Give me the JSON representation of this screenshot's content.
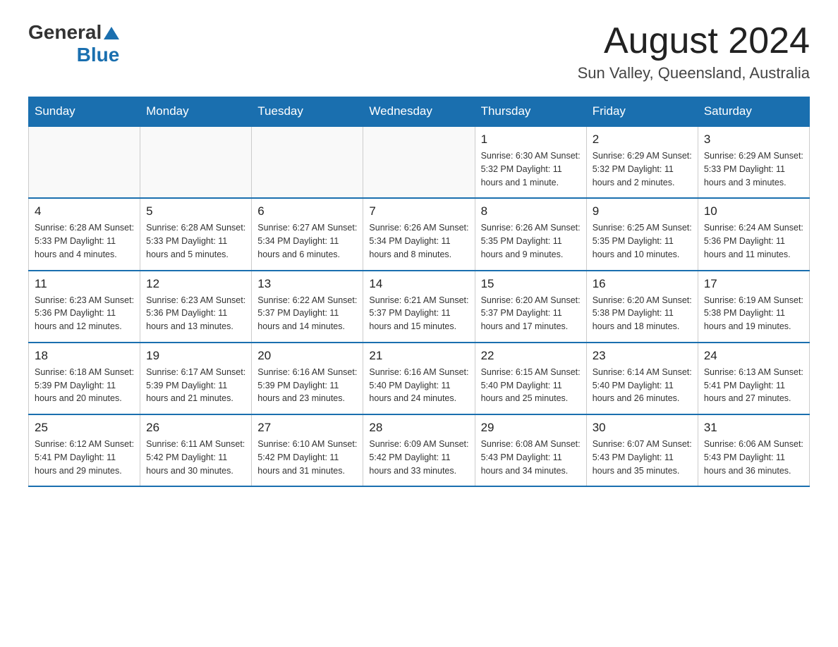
{
  "header": {
    "logo_general": "General",
    "logo_blue": "Blue",
    "month_title": "August 2024",
    "location": "Sun Valley, Queensland, Australia"
  },
  "days_of_week": [
    "Sunday",
    "Monday",
    "Tuesday",
    "Wednesday",
    "Thursday",
    "Friday",
    "Saturday"
  ],
  "weeks": [
    [
      {
        "day": "",
        "info": ""
      },
      {
        "day": "",
        "info": ""
      },
      {
        "day": "",
        "info": ""
      },
      {
        "day": "",
        "info": ""
      },
      {
        "day": "1",
        "info": "Sunrise: 6:30 AM\nSunset: 5:32 PM\nDaylight: 11 hours and 1 minute."
      },
      {
        "day": "2",
        "info": "Sunrise: 6:29 AM\nSunset: 5:32 PM\nDaylight: 11 hours and 2 minutes."
      },
      {
        "day": "3",
        "info": "Sunrise: 6:29 AM\nSunset: 5:33 PM\nDaylight: 11 hours and 3 minutes."
      }
    ],
    [
      {
        "day": "4",
        "info": "Sunrise: 6:28 AM\nSunset: 5:33 PM\nDaylight: 11 hours and 4 minutes."
      },
      {
        "day": "5",
        "info": "Sunrise: 6:28 AM\nSunset: 5:33 PM\nDaylight: 11 hours and 5 minutes."
      },
      {
        "day": "6",
        "info": "Sunrise: 6:27 AM\nSunset: 5:34 PM\nDaylight: 11 hours and 6 minutes."
      },
      {
        "day": "7",
        "info": "Sunrise: 6:26 AM\nSunset: 5:34 PM\nDaylight: 11 hours and 8 minutes."
      },
      {
        "day": "8",
        "info": "Sunrise: 6:26 AM\nSunset: 5:35 PM\nDaylight: 11 hours and 9 minutes."
      },
      {
        "day": "9",
        "info": "Sunrise: 6:25 AM\nSunset: 5:35 PM\nDaylight: 11 hours and 10 minutes."
      },
      {
        "day": "10",
        "info": "Sunrise: 6:24 AM\nSunset: 5:36 PM\nDaylight: 11 hours and 11 minutes."
      }
    ],
    [
      {
        "day": "11",
        "info": "Sunrise: 6:23 AM\nSunset: 5:36 PM\nDaylight: 11 hours and 12 minutes."
      },
      {
        "day": "12",
        "info": "Sunrise: 6:23 AM\nSunset: 5:36 PM\nDaylight: 11 hours and 13 minutes."
      },
      {
        "day": "13",
        "info": "Sunrise: 6:22 AM\nSunset: 5:37 PM\nDaylight: 11 hours and 14 minutes."
      },
      {
        "day": "14",
        "info": "Sunrise: 6:21 AM\nSunset: 5:37 PM\nDaylight: 11 hours and 15 minutes."
      },
      {
        "day": "15",
        "info": "Sunrise: 6:20 AM\nSunset: 5:37 PM\nDaylight: 11 hours and 17 minutes."
      },
      {
        "day": "16",
        "info": "Sunrise: 6:20 AM\nSunset: 5:38 PM\nDaylight: 11 hours and 18 minutes."
      },
      {
        "day": "17",
        "info": "Sunrise: 6:19 AM\nSunset: 5:38 PM\nDaylight: 11 hours and 19 minutes."
      }
    ],
    [
      {
        "day": "18",
        "info": "Sunrise: 6:18 AM\nSunset: 5:39 PM\nDaylight: 11 hours and 20 minutes."
      },
      {
        "day": "19",
        "info": "Sunrise: 6:17 AM\nSunset: 5:39 PM\nDaylight: 11 hours and 21 minutes."
      },
      {
        "day": "20",
        "info": "Sunrise: 6:16 AM\nSunset: 5:39 PM\nDaylight: 11 hours and 23 minutes."
      },
      {
        "day": "21",
        "info": "Sunrise: 6:16 AM\nSunset: 5:40 PM\nDaylight: 11 hours and 24 minutes."
      },
      {
        "day": "22",
        "info": "Sunrise: 6:15 AM\nSunset: 5:40 PM\nDaylight: 11 hours and 25 minutes."
      },
      {
        "day": "23",
        "info": "Sunrise: 6:14 AM\nSunset: 5:40 PM\nDaylight: 11 hours and 26 minutes."
      },
      {
        "day": "24",
        "info": "Sunrise: 6:13 AM\nSunset: 5:41 PM\nDaylight: 11 hours and 27 minutes."
      }
    ],
    [
      {
        "day": "25",
        "info": "Sunrise: 6:12 AM\nSunset: 5:41 PM\nDaylight: 11 hours and 29 minutes."
      },
      {
        "day": "26",
        "info": "Sunrise: 6:11 AM\nSunset: 5:42 PM\nDaylight: 11 hours and 30 minutes."
      },
      {
        "day": "27",
        "info": "Sunrise: 6:10 AM\nSunset: 5:42 PM\nDaylight: 11 hours and 31 minutes."
      },
      {
        "day": "28",
        "info": "Sunrise: 6:09 AM\nSunset: 5:42 PM\nDaylight: 11 hours and 33 minutes."
      },
      {
        "day": "29",
        "info": "Sunrise: 6:08 AM\nSunset: 5:43 PM\nDaylight: 11 hours and 34 minutes."
      },
      {
        "day": "30",
        "info": "Sunrise: 6:07 AM\nSunset: 5:43 PM\nDaylight: 11 hours and 35 minutes."
      },
      {
        "day": "31",
        "info": "Sunrise: 6:06 AM\nSunset: 5:43 PM\nDaylight: 11 hours and 36 minutes."
      }
    ]
  ]
}
